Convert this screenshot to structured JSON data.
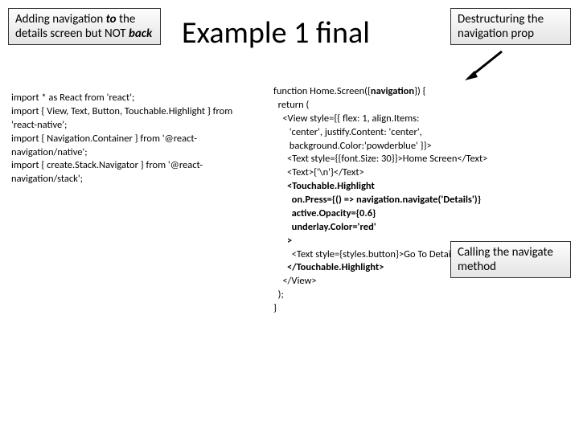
{
  "title": "Example 1 final",
  "callouts": {
    "left_html": "Adding navigation <b><i>to</i></b> the details screen but NOT <b><i>back</i></b>",
    "right_html": "Destructuring the navigation prop",
    "method_html": "Calling the navigate method"
  },
  "code": {
    "left": "import * as React from 'react';\nimport { View, Text, Button, Touchable.Highlight } from 'react-native';\nimport { Navigation.Container } from '@react-navigation/native';\nimport { create.Stack.Navigator } from '@react-navigation/stack';",
    "right_html": "function Home.Screen({<b>navigation</b>}) {\n  return (\n    &lt;View style={{ flex: 1, align.Items:\n       'center', justify.Content: 'center',\n       background.Color:'powderblue' }}&gt;\n      &lt;Text style={{font.Size: 30}}&gt;Home Screen&lt;/Text&gt;\n      &lt;Text&gt;{'\\n'}&lt;/Text&gt;\n      <b>&lt;Touchable.Highlight</b>\n        <b>on.Press={() =&gt; navigation.navigate('Details')}</b>\n        <b>active.Opacity={0.6}</b>\n        <b>underlay.Color='red'</b>\n      <b>&gt;</b>\n        &lt;Text style={styles.button}&gt;Go To Details&lt;/Text&gt;\n      <b>&lt;/Touchable.Highlight&gt;</b>\n    &lt;/View&gt;\n  );\n}"
  }
}
